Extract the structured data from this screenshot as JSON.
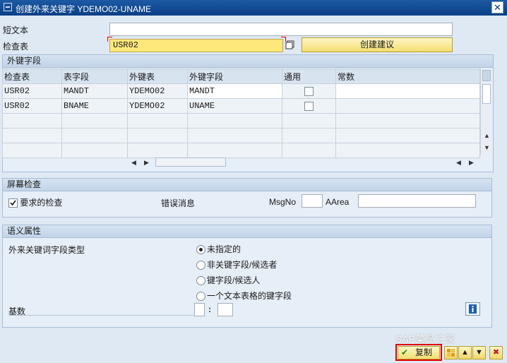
{
  "window": {
    "title": "创建外来关键字 YDEMO02-UNAME"
  },
  "header": {
    "short_text_label": "短文本",
    "short_text_value": "",
    "check_table_label": "检查表",
    "check_table_value": "USR02",
    "propose_button": "创建建议"
  },
  "foreign_key_fields": {
    "title": "外键字段",
    "columns": [
      "检查表",
      "表字段",
      "外键表",
      "外键字段",
      "通用",
      "常数"
    ],
    "rows": [
      [
        "USR02",
        "MANDT",
        "YDEMO02",
        "MANDT",
        false,
        ""
      ],
      [
        "USR02",
        "BNAME",
        "YDEMO02",
        "UNAME",
        false,
        ""
      ]
    ]
  },
  "screen_check": {
    "title": "屏幕检查",
    "required_check_label": "要求的检查",
    "required_check": true,
    "error_message_label": "错误消息",
    "msgno_label": "MsgNo",
    "msgno_value": "",
    "aarea_label": "AArea",
    "aarea_value": ""
  },
  "semantic": {
    "title": "语义属性",
    "field_type_label": "外来关键词字段类型",
    "options": [
      "未指定的",
      "非关键字段/候选者",
      "键字段/候选人",
      "一个文本表格的键字段"
    ],
    "selected_index": 0,
    "cardinality_label": "基数",
    "cardinality_separator": ":"
  },
  "footer": {
    "copy_button": "复制"
  },
  "watermark": "SAP菜鸟之家",
  "colors": {
    "accent": "#0a3f86",
    "required_field": "#ffe87a",
    "highlight_box": "#e00000"
  }
}
